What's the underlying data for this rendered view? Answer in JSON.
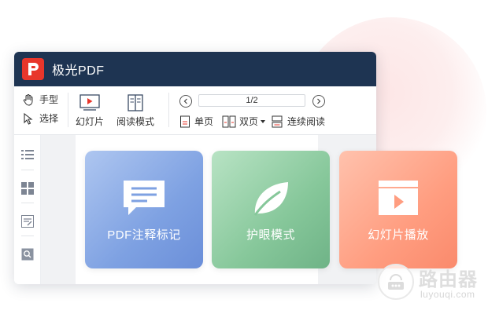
{
  "app": {
    "title": "极光PDF",
    "logo_letter": "P"
  },
  "toolbar": {
    "hand_label": "手型",
    "select_label": "选择",
    "slideshow_label": "幻灯片",
    "read_mode_label": "阅读模式",
    "page_indicator": "1/2",
    "single_page_label": "单页",
    "double_page_label": "双页",
    "continuous_label": "连续阅读"
  },
  "cards": [
    {
      "label": "PDF注释标记",
      "icon": "comment-icon",
      "color": "#7ea1e2"
    },
    {
      "label": "护眼模式",
      "icon": "leaf-icon",
      "color": "#86c79a"
    },
    {
      "label": "幻灯片播放",
      "icon": "slideshow-icon",
      "color": "#ff9d80"
    }
  ],
  "watermark": {
    "name": "路由器",
    "url": "luyouqi.com"
  },
  "colors": {
    "titlebar": "#1e3452",
    "logo": "#e8362b",
    "doc_background": "#f1f2f4"
  }
}
